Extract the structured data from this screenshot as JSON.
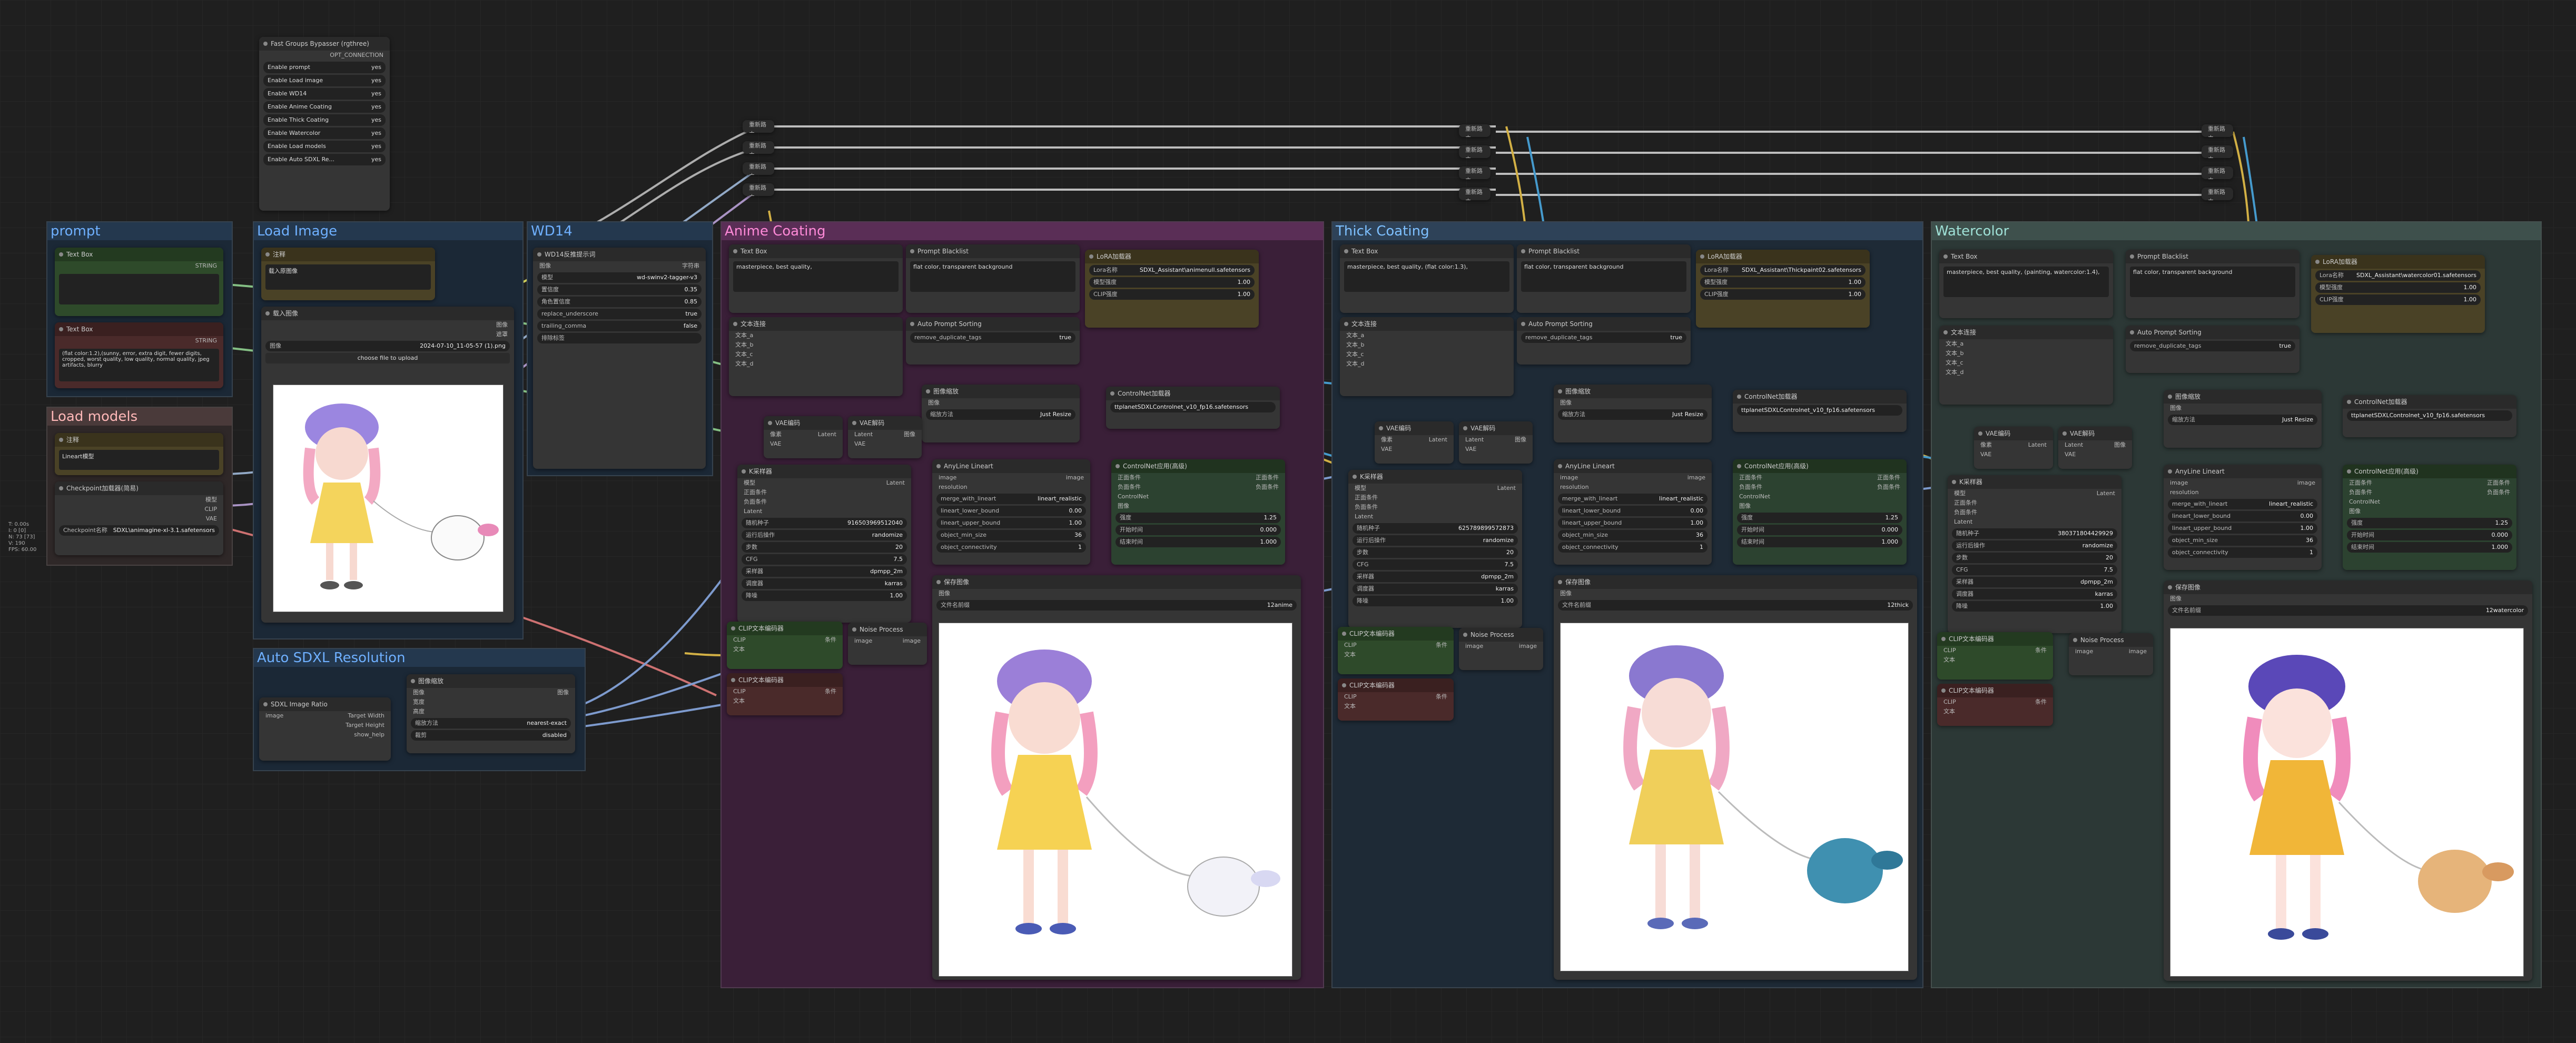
{
  "canvas": {
    "background": "#1f1f1f"
  },
  "groups": {
    "prompt": {
      "title": "prompt",
      "color": "#1a2a3a"
    },
    "load_image": {
      "title": "Load Image",
      "color": "#1a2a3a"
    },
    "wd14": {
      "title": "WD14",
      "color": "#1a2a3a"
    },
    "load_models": {
      "title": "Load models",
      "color": "#3a2e2e"
    },
    "auto_sdxl": {
      "title": "Auto SDXL Resolution",
      "color": "#1a2a3a"
    },
    "anime": {
      "title": "Anime Coating",
      "color": "#3a1f38"
    },
    "thick": {
      "title": "Thick Coating",
      "color": "#1e2a36"
    },
    "watercolor": {
      "title": "Watercolor",
      "color": "#2e3a38"
    }
  },
  "bypasser": {
    "title": "Fast Groups Bypasser (rgthree)",
    "output": "OPT_CONNECTION",
    "items": [
      {
        "label": "Enable prompt",
        "state": "yes"
      },
      {
        "label": "Enable Load image",
        "state": "yes"
      },
      {
        "label": "Enable WD14",
        "state": "yes"
      },
      {
        "label": "Enable Anime Coating",
        "state": "yes"
      },
      {
        "label": "Enable Thick Coating",
        "state": "yes"
      },
      {
        "label": "Enable Watercolor",
        "state": "yes"
      },
      {
        "label": "Enable Load models",
        "state": "yes"
      },
      {
        "label": "Enable Auto SDXL Re...",
        "state": "yes"
      }
    ]
  },
  "prompt_nodes": {
    "text_box_1": {
      "title": "Text Box",
      "output": "STRING",
      "text": ""
    },
    "text_box_2": {
      "title": "Text Box",
      "output": "STRING",
      "text": "(flat color:1.2),(sunny, error, extra digit, fewer digits, cropped, worst quality, low quality, normal quality, jpeg artifacts, blurry"
    }
  },
  "load_models": {
    "note_title": "注释",
    "note_text": "Lineart模型",
    "ckpt_title": "Checkpoint加载器(简易)",
    "ckpt_outputs": [
      "模型",
      "CLIP",
      "VAE"
    ],
    "ckpt_name": "Checkpoint名称",
    "ckpt_value": "SDXL\\animagine-xl-3.1.safetensors"
  },
  "load_image": {
    "note_title": "注释",
    "note_text": "载入原图像",
    "loader_title": "载入图像",
    "outputs": [
      "图像",
      "遮罩"
    ],
    "image_label": "图像",
    "image_value": "2024-07-10_11-05-57 (1).png",
    "upload_label": "choose file to upload"
  },
  "wd14": {
    "title": "WD14反推提示词",
    "input": "图像",
    "output": "字符串",
    "rows": [
      {
        "k": "模型",
        "v": "wd-swinv2-tagger-v3"
      },
      {
        "k": "置信度",
        "v": "0.35"
      },
      {
        "k": "角色置信度",
        "v": "0.85"
      },
      {
        "k": "replace_underscore",
        "v": "true"
      },
      {
        "k": "trailing_comma",
        "v": "false"
      },
      {
        "k": "排除标签",
        "v": ""
      }
    ]
  },
  "auto_sdxl": {
    "ratio_title": "SDXL Image Ratio",
    "ratio_input": "image",
    "ratio_outputs": [
      "Target Width",
      "Target Height",
      "show_help"
    ],
    "scale_title": "图像缩放",
    "scale_inputs": [
      "图像",
      "宽度",
      "高度"
    ],
    "scale_output": "图像",
    "scale_rows": [
      {
        "k": "缩放方法",
        "v": "nearest-exact"
      },
      {
        "k": "裁剪",
        "v": "disabled"
      }
    ]
  },
  "stages": [
    {
      "key": "anime",
      "text_box_title": "Text Box",
      "text_box_text": "masterpiece, best quality,",
      "blacklist_title": "Prompt Blacklist",
      "blacklist_text": "flat color, transparent background",
      "lora_title": "LoRA加载器",
      "lora_name": "Lora名称",
      "lora_value": "SDXL_Assistant\\animenull.safetensors",
      "lora_model_strength": "1.00",
      "lora_clip_strength": "1.00",
      "sorting_title": "Auto Prompt Sorting",
      "sorting_value": "remove_duplicate_tags",
      "concat_title": "文本连接",
      "controlnet_loader_title": "ControlNet加载器",
      "controlnet_value": "ttplanetSDXLControlnet_v10_fp16.safetensors",
      "sampler_title": "K采样器",
      "seed": "916503969512040",
      "control_after": "randomize",
      "steps": "20",
      "cfg": "7.5",
      "sampler": "dpmpp_2m",
      "scheduler": "karras",
      "denoise": "1.00",
      "lineart_title": "AnyLine Lineart",
      "lineart_rows": [
        {
          "k": "merge_with_lineart",
          "v": "lineart_realistic"
        },
        {
          "k": "lineart_lower_bound",
          "v": "0.00"
        },
        {
          "k": "lineart_upper_bound",
          "v": "1.00"
        },
        {
          "k": "object_min_size",
          "v": "36"
        },
        {
          "k": "object_connectivity",
          "v": "1"
        }
      ],
      "apply_title": "ControlNet应用(高级)",
      "apply_rows": [
        {
          "k": "强度",
          "v": "1.25"
        },
        {
          "k": "开始时间",
          "v": "0.000"
        },
        {
          "k": "结束时间",
          "v": "1.000"
        }
      ],
      "preview_title": "保存图像",
      "preview_prefix": "12anime",
      "clip_title_1": "CLIP文本编码器",
      "clip_title_2": "CLIP文本编码器",
      "noise_title": "Noise Process",
      "vae_title": "VAE编码",
      "vae_decode_title": "VAE解码",
      "resize_title": "图像缩放",
      "resize_rows": [
        {
          "k": "缩放方法",
          "v": "Just Resize"
        }
      ]
    },
    {
      "key": "thick",
      "text_box_title": "Text Box",
      "text_box_text": "masterpiece, best quality, (flat color:1.3),",
      "blacklist_title": "Prompt Blacklist",
      "blacklist_text": "flat color, transparent background",
      "lora_title": "LoRA加载器",
      "lora_name": "Lora名称",
      "lora_value": "SDXL_Assistant\\Thickpaint02.safetensors",
      "lora_model_strength": "1.00",
      "lora_clip_strength": "1.00",
      "sorting_title": "Auto Prompt Sorting",
      "sorting_value": "remove_duplicate_tags",
      "concat_title": "文本连接",
      "controlnet_loader_title": "ControlNet加载器",
      "controlnet_value": "ttplanetSDXLControlnet_v10_fp16.safetensors",
      "sampler_title": "K采样器",
      "seed": "625789899572873",
      "control_after": "randomize",
      "steps": "20",
      "cfg": "7.5",
      "sampler": "dpmpp_2m",
      "scheduler": "karras",
      "denoise": "1.00",
      "lineart_title": "AnyLine Lineart",
      "lineart_rows": [
        {
          "k": "merge_with_lineart",
          "v": "lineart_realistic"
        },
        {
          "k": "lineart_lower_bound",
          "v": "0.00"
        },
        {
          "k": "lineart_upper_bound",
          "v": "1.00"
        },
        {
          "k": "object_min_size",
          "v": "36"
        },
        {
          "k": "object_connectivity",
          "v": "1"
        }
      ],
      "apply_title": "ControlNet应用(高级)",
      "apply_rows": [
        {
          "k": "强度",
          "v": "1.25"
        },
        {
          "k": "开始时间",
          "v": "0.000"
        },
        {
          "k": "结束时间",
          "v": "1.000"
        }
      ],
      "preview_title": "保存图像",
      "preview_prefix": "12thick",
      "clip_title_1": "CLIP文本编码器",
      "clip_title_2": "CLIP文本编码器",
      "noise_title": "Noise Process",
      "vae_title": "VAE编码",
      "vae_decode_title": "VAE解码",
      "resize_title": "图像缩放",
      "resize_rows": [
        {
          "k": "缩放方法",
          "v": "Just Resize"
        }
      ]
    },
    {
      "key": "watercolor",
      "text_box_title": "Text Box",
      "text_box_text": "masterpiece, best quality, (painting, watercolor:1.4),",
      "blacklist_title": "Prompt Blacklist",
      "blacklist_text": "flat color, transparent background",
      "lora_title": "LoRA加载器",
      "lora_name": "Lora名称",
      "lora_value": "SDXL_Assistant\\watercolor01.safetensors",
      "lora_model_strength": "1.00",
      "lora_clip_strength": "1.00",
      "sorting_title": "Auto Prompt Sorting",
      "sorting_value": "remove_duplicate_tags",
      "concat_title": "文本连接",
      "controlnet_loader_title": "ControlNet加载器",
      "controlnet_value": "ttplanetSDXLControlnet_v10_fp16.safetensors",
      "sampler_title": "K采样器",
      "seed": "380371804429929",
      "control_after": "randomize",
      "steps": "20",
      "cfg": "7.5",
      "sampler": "dpmpp_2m",
      "scheduler": "karras",
      "denoise": "1.00",
      "lineart_title": "AnyLine Lineart",
      "lineart_rows": [
        {
          "k": "merge_with_lineart",
          "v": "lineart_realistic"
        },
        {
          "k": "lineart_lower_bound",
          "v": "0.00"
        },
        {
          "k": "lineart_upper_bound",
          "v": "1.00"
        },
        {
          "k": "object_min_size",
          "v": "36"
        },
        {
          "k": "object_connectivity",
          "v": "1"
        }
      ],
      "apply_title": "ControlNet应用(高级)",
      "apply_rows": [
        {
          "k": "强度",
          "v": "1.25"
        },
        {
          "k": "开始时间",
          "v": "0.000"
        },
        {
          "k": "结束时间",
          "v": "1.000"
        }
      ],
      "preview_title": "保存图像",
      "preview_prefix": "12watercolor",
      "clip_title_1": "CLIP文本编码器",
      "clip_title_2": "CLIP文本编码器",
      "noise_title": "Noise Process",
      "vae_title": "VAE编码",
      "vae_decode_title": "VAE解码",
      "resize_title": "图像缩放",
      "resize_rows": [
        {
          "k": "缩放方法",
          "v": "Just Resize"
        }
      ]
    }
  ],
  "reroutes": {
    "label": "重新路由"
  },
  "side_info": [
    "T: 0.00s",
    "I: 0 [0]",
    "N: 73 [73]",
    "V: 190",
    "FPS: 60.00"
  ]
}
